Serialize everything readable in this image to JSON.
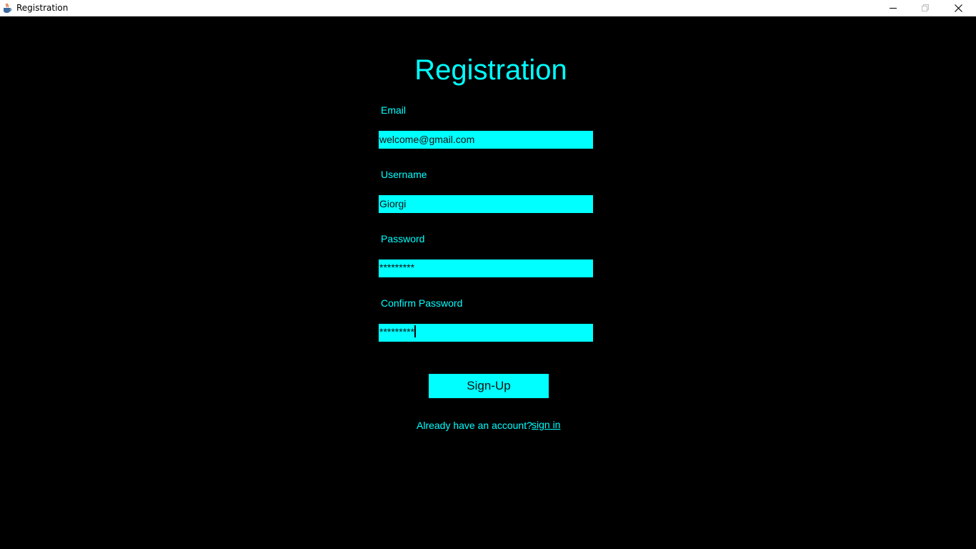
{
  "window": {
    "title": "Registration",
    "app_icon": "java-cup-icon",
    "controls": {
      "minimize": "minimize-icon",
      "maximize": "maximize-icon",
      "close": "close-icon"
    }
  },
  "form": {
    "heading": "Registration",
    "fields": [
      {
        "label": "Email",
        "value": "welcome@gmail.com"
      },
      {
        "label": "Username",
        "value": "Giorgi"
      },
      {
        "label": "Password",
        "value": "*********"
      },
      {
        "label": "Confirm Password",
        "value": "*********"
      }
    ],
    "submit_label": "Sign-Up",
    "account_prompt": "Already have an account?",
    "signin_link": "sign in"
  },
  "colors": {
    "background": "#000000",
    "accent": "#00ffff",
    "titlebar": "#ffffff"
  }
}
